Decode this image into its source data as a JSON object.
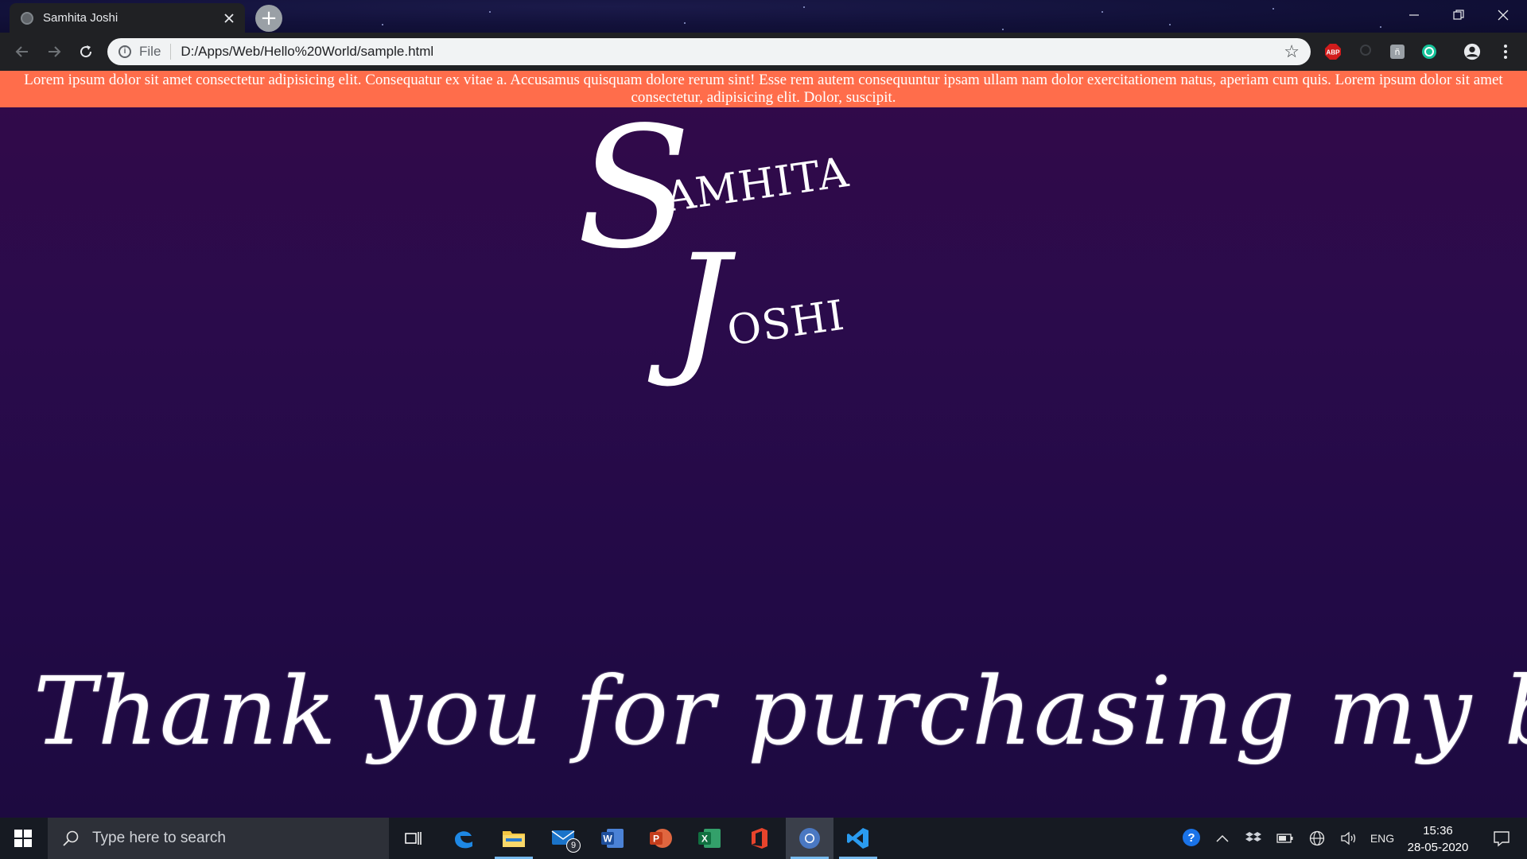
{
  "browser": {
    "tab_title": "Samhita Joshi",
    "new_tab_symbol": "+",
    "url_scheme": "File",
    "url": "D:/Apps/Web/Hello%20World/sample.html",
    "extensions": [
      "adblock-plus-icon",
      "incognito-extension-icon",
      "extension-icon",
      "grammarly-icon",
      "profile-icon",
      "menu-icon"
    ],
    "extension_abp_label": "ABP"
  },
  "page": {
    "banner_text": "Lorem ipsum dolor sit amet consectetur adipisicing elit. Consequatur ex vitae a. Accusamus quisquam dolore rerum sint! Esse rem autem consequuntur ipsam ullam nam dolor exercitationem natus, aperiam cum quis. Lorem ipsum dolor sit amet consectetur, adipisicing elit. Dolor, suscipit.",
    "logo_first_initial": "S",
    "logo_first_rest": "AMHITA",
    "logo_last_initial": "J",
    "logo_last_rest": "OSHI",
    "headline": "Thank you for purchasing my book. Your book is",
    "banner_color": "#ff6d4b",
    "background_color": "#2a0b4b"
  },
  "taskbar": {
    "search_placeholder": "Type here to search",
    "mail_badge": "9",
    "language": "ENG",
    "time": "15:36",
    "date": "28-05-2020",
    "apps": [
      "task-view-icon",
      "edge-icon",
      "file-explorer-icon",
      "mail-icon",
      "word-icon",
      "powerpoint-icon",
      "excel-icon",
      "office-icon",
      "chrome-icon",
      "vscode-icon"
    ]
  }
}
